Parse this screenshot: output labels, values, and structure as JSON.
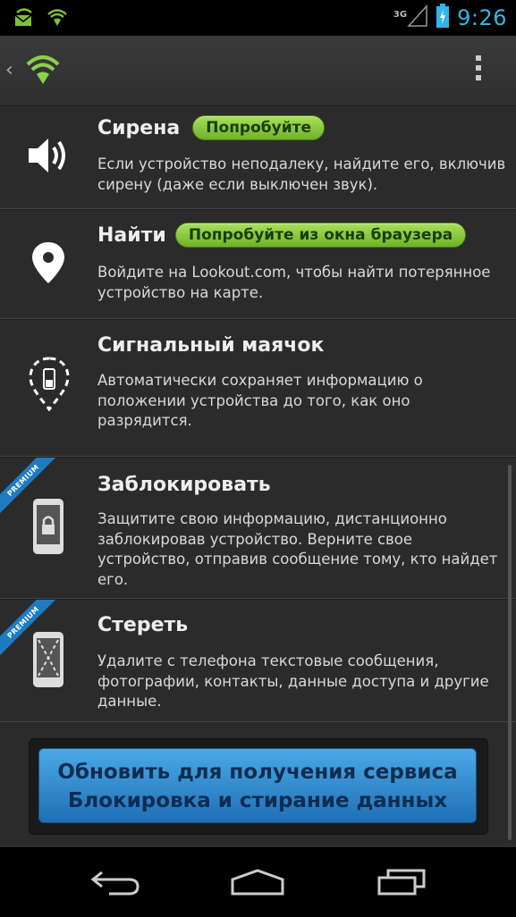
{
  "status_bar": {
    "time": "9:26",
    "network": "3G",
    "icons": [
      "lookout-mail-icon",
      "lookout-shield-icon",
      "signal-icon",
      "battery-icon"
    ]
  },
  "action_bar": {
    "icons": [
      "back-caret-icon",
      "lookout-logo-icon",
      "overflow-menu-icon"
    ]
  },
  "items": [
    {
      "title": "Сирена",
      "button": "Попробуйте",
      "description": "Если устройство неподалеку, найдите его, включив сирену (даже если выключен звук).",
      "icon": "speaker-icon"
    },
    {
      "title": "Найти",
      "button": "Попробуйте из окна браузера",
      "description": "Войдите на Lookout.com, чтобы найти потерянное устройство на карте.",
      "icon": "location-pin-icon"
    },
    {
      "title": "Сигнальный маячок",
      "description": "Автоматически сохраняет информацию о положении устройства до того, как оно разрядится.",
      "icon": "signal-flare-icon"
    },
    {
      "title": "Заблокировать",
      "badge": "PREMIUM",
      "description": "Защитите свою информацию, дистанционно заблокировав устройство. Верните свое устройство, отправив сообщение тому, кто найдет его.",
      "icon": "phone-lock-icon"
    },
    {
      "title": "Стереть",
      "badge": "PREMIUM",
      "description": "Удалите с телефона текстовые сообщения, фотографии, контакты, данные доступа и другие данные.",
      "icon": "phone-wipe-icon"
    }
  ],
  "upgrade_button": {
    "line1": "Обновить для получения сервиса",
    "line2": "Блокировка и стирание данных"
  },
  "nav_bar": {
    "icons": [
      "back-icon",
      "home-icon",
      "recent-apps-icon"
    ]
  },
  "colors": {
    "accent": "#33b5e5",
    "pill_green": "#8fcf45",
    "premium_blue": "#1e7bc2",
    "upgrade_blue": "#2f8bd0"
  }
}
